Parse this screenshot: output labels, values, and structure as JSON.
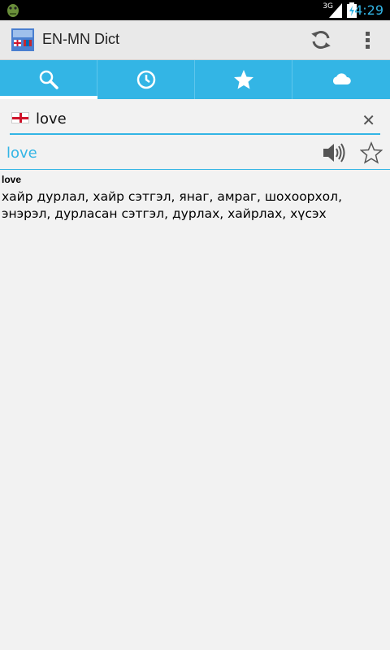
{
  "status_bar": {
    "time": "4:29",
    "network": "3G",
    "accent_color": "#33b5e5"
  },
  "app_bar": {
    "title": "EN-MN Dict",
    "icons": [
      "app-logo-icon",
      "refresh-icon",
      "overflow-menu-icon"
    ]
  },
  "tabs": [
    {
      "icon": "search-icon",
      "selected": true
    },
    {
      "icon": "history-clock-icon",
      "selected": false
    },
    {
      "icon": "favorites-star-icon",
      "selected": false
    },
    {
      "icon": "cloud-icon",
      "selected": false
    }
  ],
  "search": {
    "value": "love",
    "language_flag": "england-flag-icon"
  },
  "result": {
    "word": "love",
    "entry_head": "love",
    "definition": "хайр дурлал, хайр сэтгэл, янаг, амраг, шохоорхол, энэрэл, дурласан сэтгэл, дурлах, хайрлах, хүсэх"
  },
  "colors": {
    "accent": "#33b5e5",
    "tab_bar": "#33b5e5",
    "action_bar": "#e9e9e9",
    "background": "#f2f2f2"
  }
}
